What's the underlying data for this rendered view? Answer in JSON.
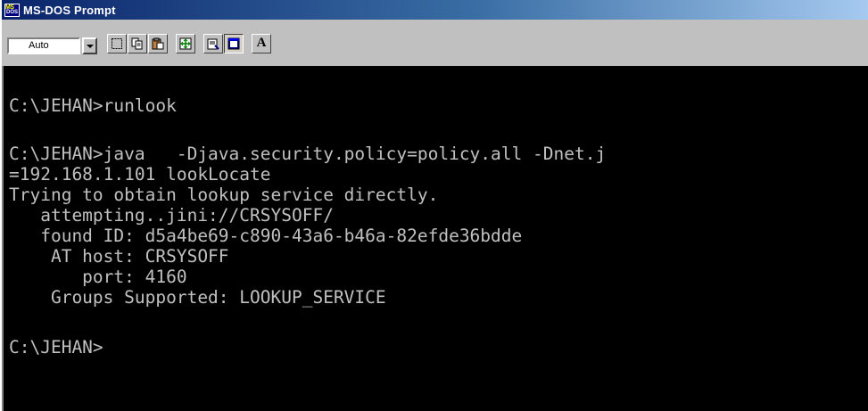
{
  "window": {
    "title": "MS-DOS Prompt"
  },
  "toolbar": {
    "font_size_value": "Auto",
    "font_button_label": "A"
  },
  "terminal": {
    "lines": {
      "l1": "C:\\JEHAN>runlook",
      "l2": "C:\\JEHAN>java   -Djava.security.policy=policy.all -Dnet.j",
      "l3": "=192.168.1.101 lookLocate",
      "l4": "Trying to obtain lookup service directly.",
      "l5": "   attempting..jini://CRSYSOFF/",
      "l6": "   found ID: d5a4be69-c890-43a6-b46a-82efde36bdde",
      "l7": "    AT host: CRSYSOFF",
      "l8": "       port: 4160",
      "l9": "    Groups Supported: LOOKUP_SERVICE",
      "l10": "C:\\JEHAN>"
    }
  },
  "colors": {
    "terminal_bg": "#000000",
    "terminal_fg": "#c0c0c0",
    "titlebar_start": "#0a246a",
    "titlebar_end": "#a6caf0"
  },
  "icons": [
    "msdos-app-icon",
    "dropdown-arrow-icon",
    "mark-icon",
    "copy-icon",
    "paste-icon",
    "fullscreen-icon",
    "properties-icon",
    "background-icon",
    "font-icon"
  ]
}
